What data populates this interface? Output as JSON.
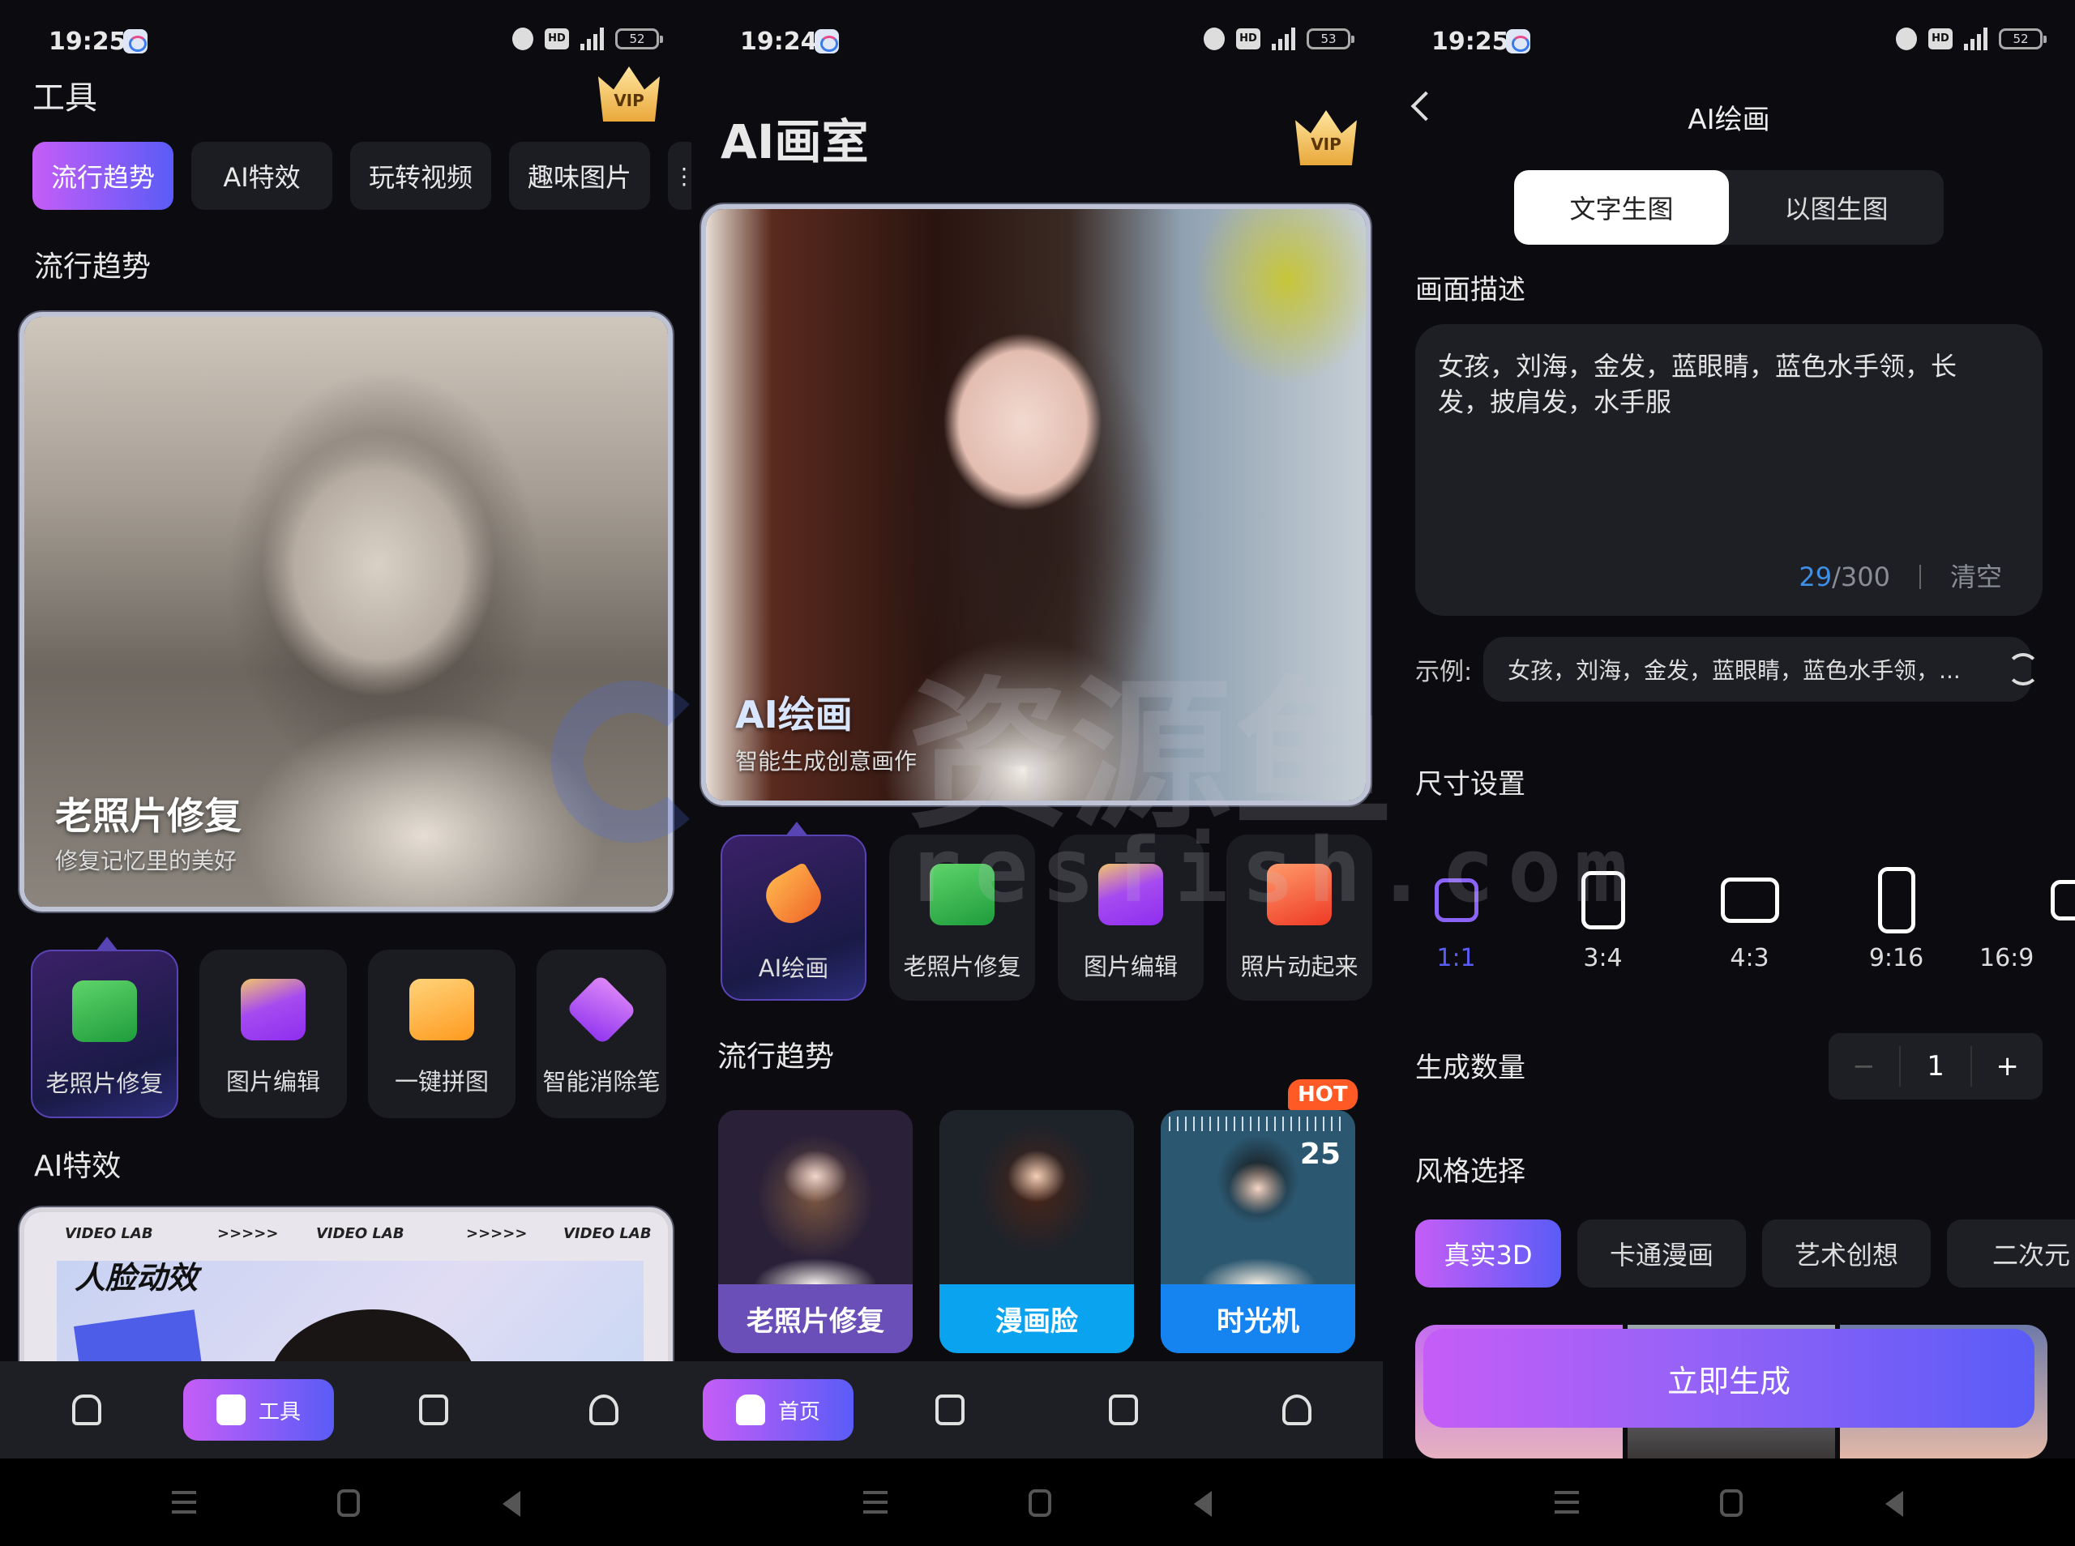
{
  "colors": {
    "accent_start": "#c55df7",
    "accent_end": "#5a5cf7",
    "counter_blue": "#3e8fe6",
    "hot": "#ff5a26"
  },
  "status_bars": [
    {
      "time": "19:25",
      "battery": "52"
    },
    {
      "time": "19:24",
      "battery": "53"
    },
    {
      "time": "19:25",
      "battery": "52"
    }
  ],
  "vip_label": "VIP",
  "tools_page": {
    "title": "工具",
    "tabs": [
      {
        "label": "流行趋势",
        "active": true
      },
      {
        "label": "AI特效"
      },
      {
        "label": "玩转视频"
      },
      {
        "label": "趣味图片"
      }
    ],
    "more_icon": "more-vertical-icon",
    "section_trending": "流行趋势",
    "hero": {
      "title": "老照片修复",
      "subtitle": "修复记忆里的美好"
    },
    "tools": [
      {
        "label": "老照片修复",
        "icon": "wrench-icon",
        "active": true
      },
      {
        "label": "图片编辑",
        "icon": "edit-pen-icon"
      },
      {
        "label": "一键拼图",
        "icon": "puzzle-icon"
      },
      {
        "label": "智能消除笔",
        "icon": "eraser-icon"
      }
    ],
    "section_effects": "AI特效",
    "effect_card": {
      "title": "人脸动效",
      "banner": "VIDEO LAB",
      "arrows": ">>>>>"
    },
    "nav": [
      {
        "icon": "home-icon"
      },
      {
        "icon": "toolbox-icon",
        "label": "工具",
        "active": true
      },
      {
        "icon": "folder-icon"
      },
      {
        "icon": "user-icon"
      }
    ]
  },
  "home_page": {
    "title": "AI画室",
    "hero": {
      "title": "AI绘画",
      "subtitle": "智能生成创意画作"
    },
    "tools": [
      {
        "label": "AI绘画",
        "icon": "paintbrush-icon",
        "active": true
      },
      {
        "label": "老照片修复",
        "icon": "wrench-icon"
      },
      {
        "label": "图片编辑",
        "icon": "edit-pen-icon"
      },
      {
        "label": "照片动起来",
        "icon": "image-animate-icon"
      }
    ],
    "section_trending": "流行趋势",
    "trending": [
      {
        "label": "老照片修复",
        "color": "#6a4fb8"
      },
      {
        "label": "漫画脸",
        "color": "#0aa3ef"
      },
      {
        "label": "时光机",
        "color": "#1684f0",
        "badge": "HOT",
        "age": "25"
      }
    ],
    "nav": [
      {
        "icon": "home-icon",
        "label": "首页",
        "active": true
      },
      {
        "icon": "toolbox-icon"
      },
      {
        "icon": "folder-icon"
      },
      {
        "icon": "user-icon"
      }
    ]
  },
  "paint_page": {
    "title": "AI绘画",
    "modes": [
      {
        "label": "文字生图",
        "active": true
      },
      {
        "label": "以图生图"
      }
    ],
    "desc_label": "画面描述",
    "prompt": "女孩，刘海，金发，蓝眼睛，蓝色水手领，长发，披肩发，水手服",
    "count_current": "29",
    "count_max": "/300",
    "clear_label": "清空",
    "example_label": "示例:",
    "example_text": "女孩，刘海，金发，蓝眼睛，蓝色水手领，...",
    "size_label": "尺寸设置",
    "ratios": [
      {
        "label": "1:1",
        "active": true
      },
      {
        "label": "3:4"
      },
      {
        "label": "4:3"
      },
      {
        "label": "9:16"
      },
      {
        "label": "16:9"
      }
    ],
    "quantity_label": "生成数量",
    "quantity": "1",
    "minus": "−",
    "plus": "+",
    "style_label": "风格选择",
    "styles": [
      {
        "label": "真实3D",
        "active": true
      },
      {
        "label": "卡通漫画"
      },
      {
        "label": "艺术创想"
      },
      {
        "label": "二次元"
      }
    ],
    "generate_label": "立即生成"
  },
  "watermark": {
    "cn": "资源鱼",
    "en": "resfish.com"
  }
}
